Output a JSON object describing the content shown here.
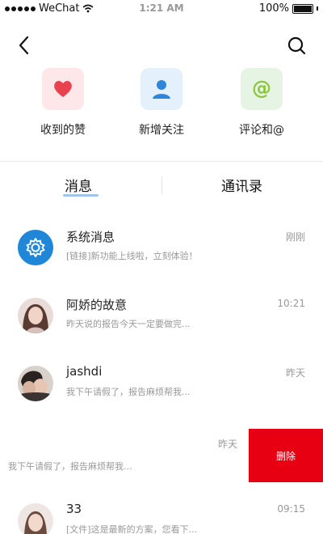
{
  "status_bar": {
    "carrier": "WeChat",
    "time": "1:21 AM",
    "battery": "100%"
  },
  "nav": {
    "back_icon": "chevron-left-icon",
    "search_icon": "search-icon"
  },
  "quick_actions": [
    {
      "label": "收到的赞",
      "icon": "heart-icon",
      "color": "#e8424f"
    },
    {
      "label": "新增关注",
      "icon": "person-icon",
      "color": "#2f86d8"
    },
    {
      "label": "评论和@",
      "icon": "at-icon",
      "color": "#8cc63f"
    }
  ],
  "tabs": [
    {
      "label": "消息",
      "active": true
    },
    {
      "label": "通讯录",
      "active": false
    }
  ],
  "conversations": [
    {
      "name": "系统消息",
      "preview": "[链接]新功能上线啦，立刻体验！",
      "time": "刚刚",
      "avatar": "gear-icon"
    },
    {
      "name": "阿娇的故意",
      "preview": "昨天说的报告今天一定要做完...",
      "time": "10:21",
      "avatar": "user-photo"
    },
    {
      "name": "jashdi",
      "preview": "我下午请假了，报告麻烦帮我...",
      "time": "昨天",
      "avatar": "user-photo"
    },
    {
      "name": "",
      "preview": "我下午请假了，报告麻烦帮我...",
      "time": "昨天",
      "action": "删除"
    },
    {
      "name": "33",
      "preview": "[文件]这是最新的方案，您看下...",
      "time": "09:15",
      "avatar": "user-photo"
    }
  ],
  "colors": {
    "accent_red": "#e60012",
    "tab_underline": "#9ec6ea"
  }
}
